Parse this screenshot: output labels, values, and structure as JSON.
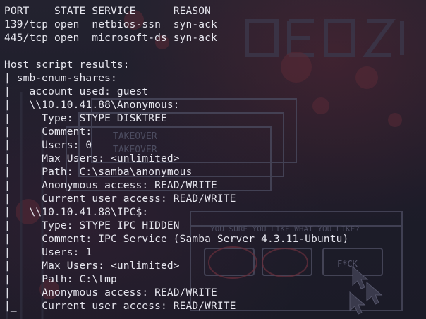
{
  "terminal": {
    "lines": [
      "PORT    STATE SERVICE      REASON",
      "139/tcp open  netbios-ssn  syn-ack",
      "445/tcp open  microsoft-ds syn-ack",
      "",
      "Host script results:",
      "| smb-enum-shares:",
      "|   account_used: guest",
      "|   \\\\10.10.41.88\\Anonymous:",
      "|     Type: STYPE_DISKTREE",
      "|     Comment:",
      "|     Users: 0",
      "|     Max Users: <unlimited>",
      "|     Path: C:\\samba\\anonymous",
      "|     Anonymous access: READ/WRITE",
      "|     Current user access: READ/WRITE",
      "|   \\\\10.10.41.88\\IPC$:",
      "|     Type: STYPE_IPC_HIDDEN",
      "|     Comment: IPC Service (Samba Server 4.3.11-Ubuntu)",
      "|     Users: 1",
      "|     Max Users: <unlimited>",
      "|     Path: C:\\tmp",
      "|     Anonymous access: READ/WRITE",
      "|_    Current user access: READ/WRITE"
    ]
  },
  "wallpaper": {
    "texts": [
      "TAKEOVER",
      "TAKEOVER",
      "YOU SURE YOU LIKE WHAT YOU LIKE?",
      "F*CK"
    ]
  },
  "colors": {
    "foreground": "#e6e6ee",
    "background": "#1d1c29",
    "wallpaper_ink": "#3a3a4c"
  }
}
